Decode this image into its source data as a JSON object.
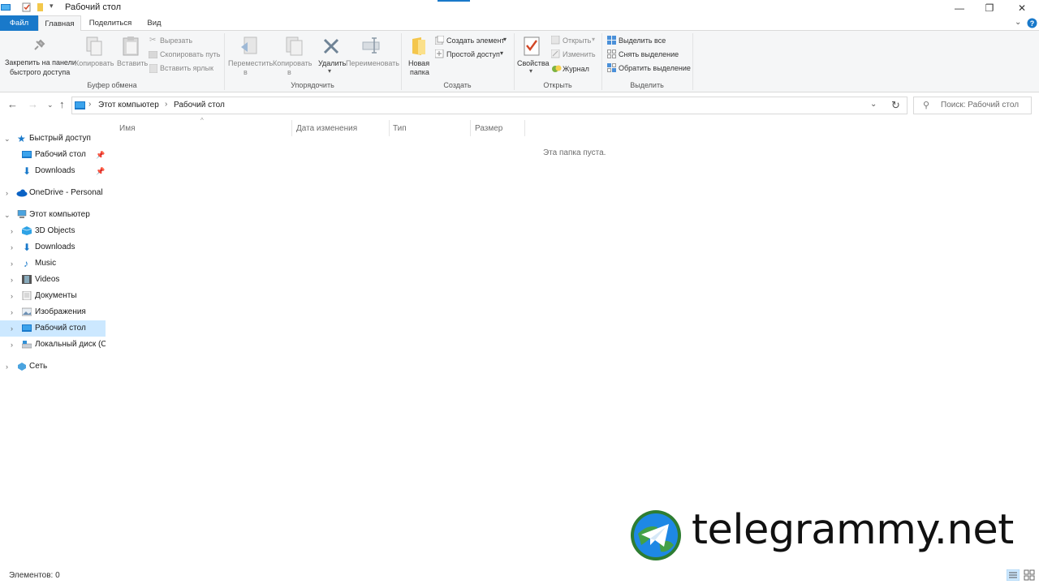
{
  "window": {
    "title": "Рабочий стол",
    "minimize": "—",
    "restore": "❐",
    "close": "✕"
  },
  "tabs": [
    "Файл",
    "Главная",
    "Поделиться",
    "Вид"
  ],
  "ribbon": {
    "clipboard": {
      "pin_label_1": "Закрепить на панели",
      "pin_label_2": "быстрого доступа",
      "copy": "Копировать",
      "paste": "Вставить",
      "cut": "Вырезать",
      "copy_path": "Скопировать путь",
      "paste_shortcut": "Вставить ярлык",
      "group": "Буфер обмена"
    },
    "organize": {
      "move_1": "Переместить",
      "move_2": "в",
      "copy_to_1": "Копировать",
      "copy_to_2": "в",
      "delete": "Удалить",
      "rename": "Переименовать",
      "group": "Упорядочить"
    },
    "create": {
      "new_folder_1": "Новая",
      "new_folder_2": "папка",
      "new_item": "Создать элемент",
      "easy_access": "Простой доступ",
      "group": "Создать"
    },
    "open": {
      "properties": "Свойства",
      "open": "Открыть",
      "edit": "Изменить",
      "history": "Журнал",
      "group": "Открыть"
    },
    "select": {
      "select_all": "Выделить все",
      "select_none": "Снять выделение",
      "invert": "Обратить выделение",
      "group": "Выделить"
    }
  },
  "address": {
    "path": [
      "Этот компьютер",
      "Рабочий стол"
    ],
    "search_placeholder": "Поиск: Рабочий стол"
  },
  "columns": [
    "Имя",
    "Дата изменения",
    "Тип",
    "Размер"
  ],
  "empty_message": "Эта папка пуста.",
  "tree": {
    "quick_access": "Быстрый доступ",
    "qa_desktop": "Рабочий стол",
    "qa_downloads": "Downloads",
    "onedrive": "OneDrive - Personal",
    "this_pc": "Этот компьютер",
    "objects3d": "3D Objects",
    "downloads": "Downloads",
    "music": "Music",
    "videos": "Videos",
    "documents": "Документы",
    "images": "Изображения",
    "desktop": "Рабочий стол",
    "local_disk": "Локальный диск (C",
    "network": "Сеть"
  },
  "status": "Элементов: 0",
  "watermark": "telegrammy.net",
  "colors": {
    "accent": "#1979ca",
    "selection": "#cce8ff",
    "ribbon_bg": "#f5f6f7"
  }
}
